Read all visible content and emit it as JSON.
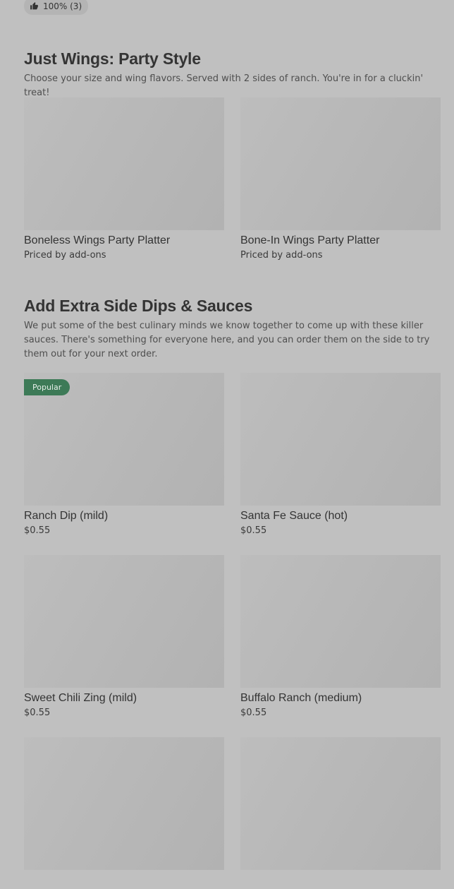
{
  "rating": {
    "text": "100% (3)",
    "icon": "thumbs-up-icon"
  },
  "sections": [
    {
      "title": "Just Wings: Party Style",
      "description": "Choose your size and wing flavors. Served with 2 sides of ranch. You're in for a cluckin' treat!",
      "items": [
        {
          "name": "Boneless Wings Party Platter",
          "price": "Priced by add-ons"
        },
        {
          "name": "Bone-In Wings Party Platter",
          "price": "Priced by add-ons"
        }
      ]
    },
    {
      "title": "Add Extra Side Dips & Sauces",
      "description": "We put some of the best culinary minds we know together to come up with these killer sauces. There's something for everyone here, and you can order them on the side to try them out for your next order.",
      "items": [
        {
          "name": "Ranch Dip (mild)",
          "price": "$0.55",
          "badge": "Popular"
        },
        {
          "name": "Santa Fe Sauce (hot)",
          "price": "$0.55"
        },
        {
          "name": "Sweet Chili Zing (mild)",
          "price": "$0.55"
        },
        {
          "name": "Buffalo Ranch (medium)",
          "price": "$0.55"
        },
        {
          "name": "",
          "price": ""
        },
        {
          "name": "",
          "price": ""
        }
      ]
    }
  ],
  "colors": {
    "background": "#c0c0c0",
    "badge": "#3d7a57",
    "image_placeholder": "#b8b8b8"
  }
}
